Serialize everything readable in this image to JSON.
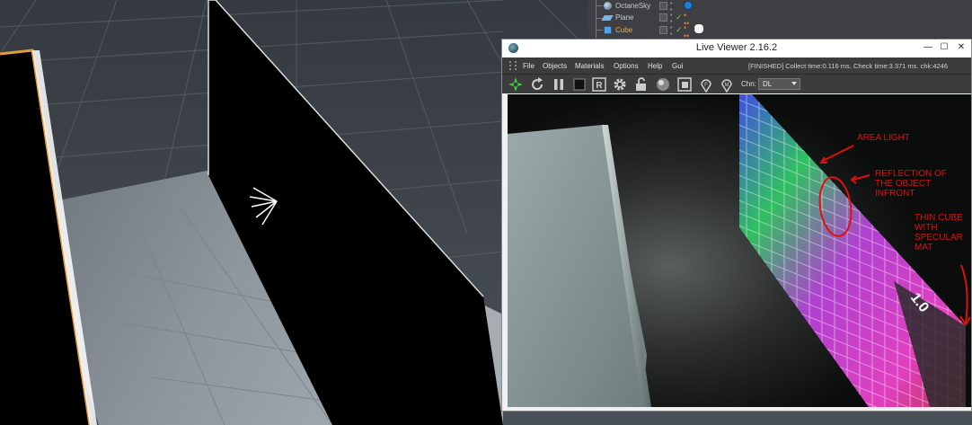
{
  "object_manager": {
    "objects": [
      {
        "name": "OctaneSky",
        "icon": "sky-icon",
        "highlighted": false
      },
      {
        "name": "Plane",
        "icon": "plane-icon",
        "highlighted": false
      },
      {
        "name": "Cube",
        "icon": "cube-icon",
        "highlighted": true
      }
    ],
    "colors": {
      "text": "#c8c8c8",
      "selected_text": "#f0b040",
      "octane_tag": "#1f7fd9"
    }
  },
  "live_viewer": {
    "title": "Live Viewer 2.16.2",
    "menu": [
      "File",
      "Objects",
      "Materials",
      "Options",
      "Help",
      "Gui"
    ],
    "status": "[FINISHED] Collect time:0.116 ms.  Check time:3.371 ms.  chk:4246",
    "toolbar_icons": [
      "send-scene-icon",
      "restart-icon",
      "pause-icon",
      "stop-icon",
      "region-render-icon",
      "settings-gear-icon",
      "lock-icon",
      "material-ball-icon",
      "clay-mode-icon",
      "focus-picker-icon",
      "material-picker-icon"
    ],
    "channel": {
      "label": "Chn:",
      "value": "DL"
    }
  },
  "annotations": {
    "area_light": "AREA LIGHT",
    "reflection": [
      "REFLECTION OF",
      "THE OBJECT",
      "INFRONT"
    ],
    "thin_cube": [
      "THIN CUBE",
      "WITH",
      "SPECULAR",
      "MAT"
    ],
    "color": "#e01010"
  }
}
